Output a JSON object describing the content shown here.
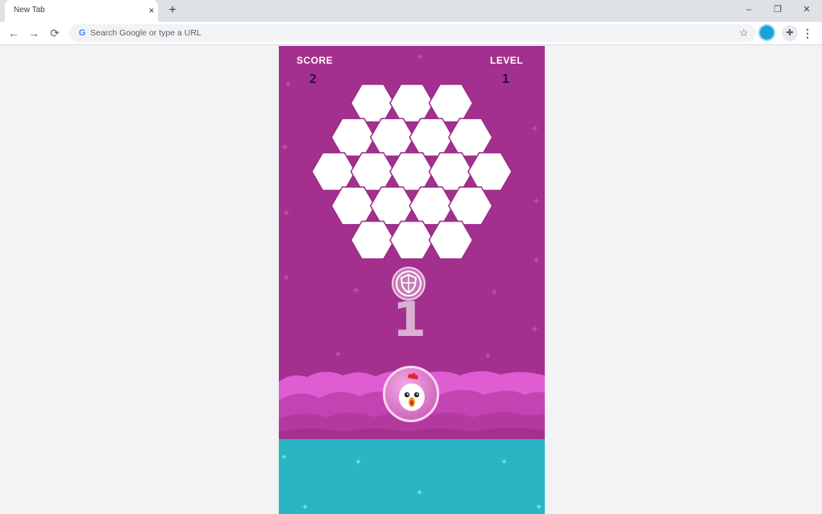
{
  "browser": {
    "tab_title": "New Tab",
    "tab_close_icon": "×",
    "new_tab_icon": "+",
    "omnibox_placeholder": "Search Google or type a URL",
    "google_glyph": "G",
    "controls": {
      "minimize": "–",
      "restore": "❐",
      "close": "✕"
    },
    "nav": {
      "back": "←",
      "forward": "→",
      "reload": "⟳"
    },
    "star_icon": "☆",
    "extensions_icon": "✚",
    "menu_icon": "⋮"
  },
  "game": {
    "score_label": "SCORE",
    "score_value": "2",
    "level_label": "LEVEL",
    "level_value": "1",
    "shield_count": "1",
    "colors": {
      "background": "#a3308e",
      "cloud_light": "#e05cd2",
      "cloud_dark": "#c244b3",
      "water": "#29b5c4",
      "hex_fill": "#ffffff"
    },
    "hex_rows": [
      3,
      4,
      5,
      4,
      3
    ]
  }
}
